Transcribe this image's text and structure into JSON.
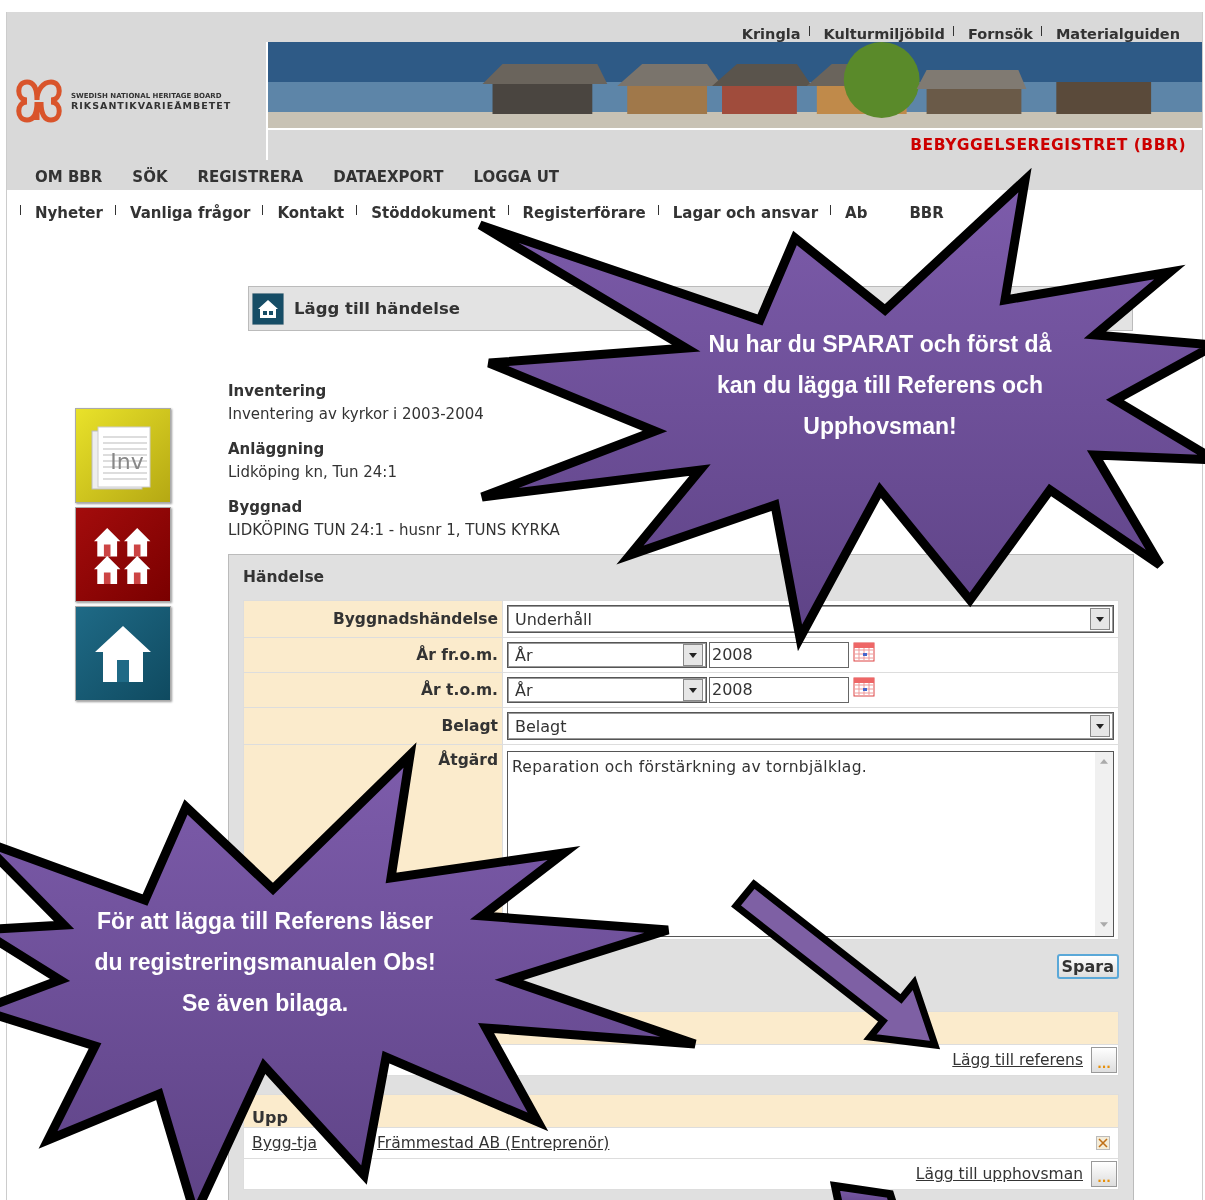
{
  "top_links": [
    "Kringla",
    "Kulturmiljöbild",
    "Fornsök",
    "Materialguiden"
  ],
  "logo": {
    "line1": "SWEDISH NATIONAL HERITAGE BOARD",
    "line2": "RIKSANTIKVARIEÄMBETET"
  },
  "site_title": "BEBYGGELSEREGISTRET (BBR)",
  "main_nav": [
    "OM BBR",
    "SÖK",
    "REGISTRERA",
    "DATAEXPORT",
    "LOGGA UT"
  ],
  "sub_nav": [
    "Nyheter",
    "Vanliga frågor",
    "Kontakt",
    "Stöddokument",
    "Registerförare",
    "Lagar och ansvar",
    "Ab"
  ],
  "sub_nav_fragment": "BBR",
  "page_header": {
    "title": "Lägg till händelse"
  },
  "side_tiles": [
    {
      "kind": "inventory",
      "label": "Inv"
    },
    {
      "kind": "buildings"
    },
    {
      "kind": "building"
    }
  ],
  "info": [
    {
      "label": "Inventering",
      "value": "Inventering av kyrkor i 2003-2004"
    },
    {
      "label": "Anläggning",
      "value": "Lidköping kn, Tun 24:1"
    },
    {
      "label": "Byggnad",
      "value": "LIDKÖPING TUN 24:1 - husnr 1, TUNS KYRKA"
    }
  ],
  "event_panel": {
    "title": "Händelse",
    "fields": [
      {
        "kind": "select",
        "label": "Byggnadshändelse",
        "value": "Underhåll"
      },
      {
        "kind": "year",
        "label": "År fr.o.m.",
        "select": "År",
        "value": "2008"
      },
      {
        "kind": "year",
        "label": "År t.o.m.",
        "select": "År",
        "value": "2008"
      },
      {
        "kind": "select",
        "label": "Belagt",
        "value": "Belagt"
      },
      {
        "kind": "textarea",
        "label": "Åtgärd",
        "value": "Reparation och förstärkning av tornbjälklag."
      }
    ],
    "save_button": "Spara"
  },
  "references": {
    "add_link": "Lägg till referens",
    "add_button": "..."
  },
  "originators": {
    "heading": "Upp",
    "item_parts": [
      "Bygg-tja",
      "Främmestad AB (Entreprenör)"
    ],
    "add_link": "Lägg till upphovsman",
    "add_button": "..."
  },
  "callouts": [
    {
      "lines": [
        "Nu har du SPARAT och först då",
        "kan du lägga till Referens och",
        "Upphovsman!"
      ]
    },
    {
      "lines": [
        "För att lägga till Referens läser",
        "du registreringsmanualen  Obs!",
        "Se även bilaga."
      ]
    }
  ]
}
